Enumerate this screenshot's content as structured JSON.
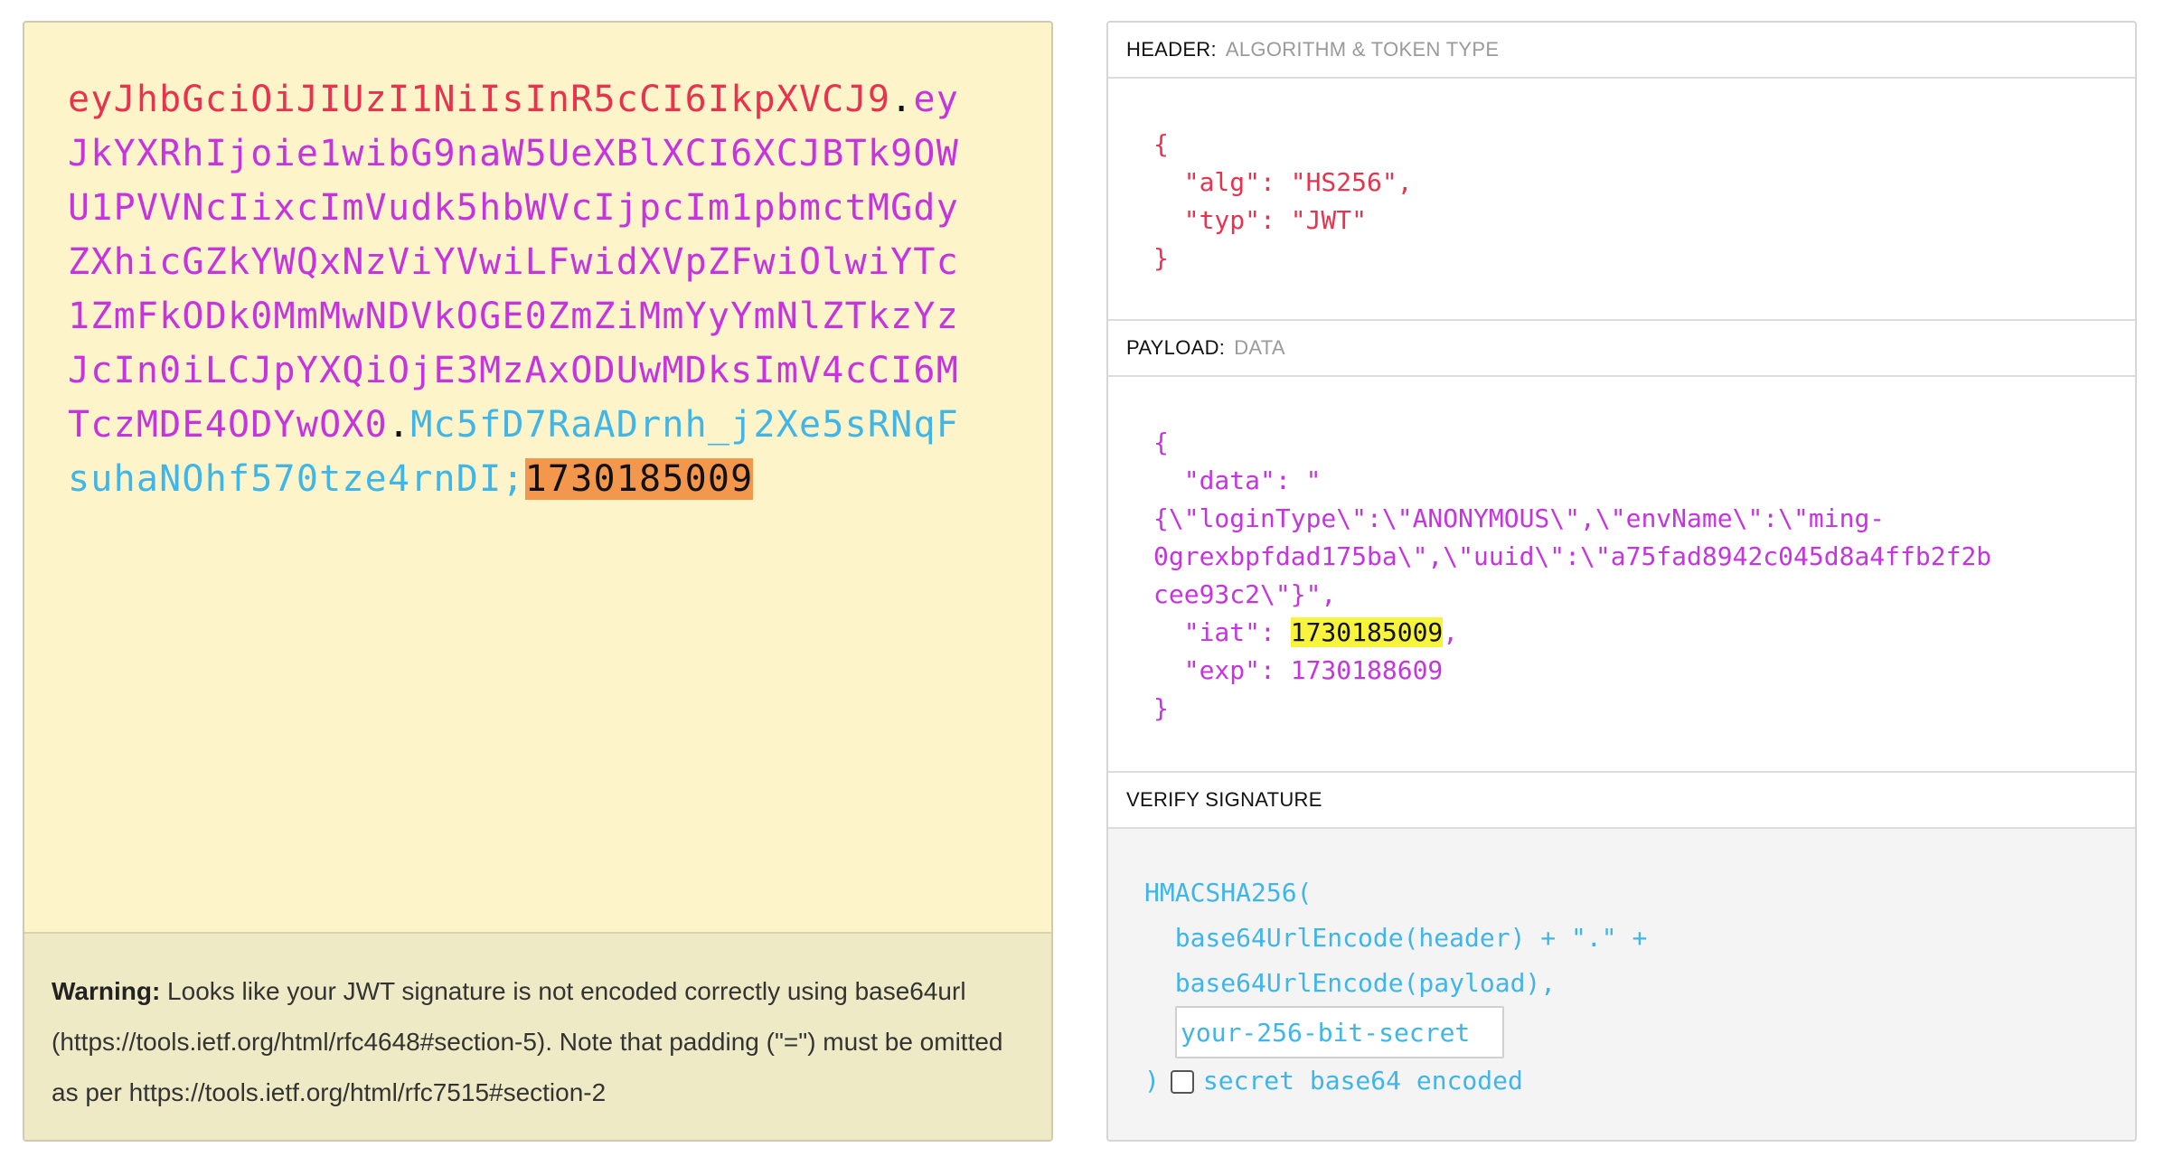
{
  "encoded": {
    "header": "eyJhbGciOiJIUzI1NiIsInR5cCI6IkpXVCJ9",
    "dot1": ".",
    "payload": "eyJkYXRhIjoie1wibG9naW5UeXBlXCI6XCJBTk9OWU1PVVNcIixcImVudk5hbWVcIjpcIm1pbmctMGdyZXhicGZkYWQxNzViYVwiLFwidXVpZFwiOlwiYTc1ZmFkODk0MmMwNDVkOGE0ZmZiMmYyYmNlZTkzYzJcIn0iLCJpYXQiOjE3MzAxODUwMDksImV4cCI6MTczMDE4ODYwOX0",
    "dot2": ".",
    "signature": "Mc5fD7RaADrnh_j2Xe5sRNqFsuhaNOhf570tze4rnDI;",
    "invalid_suffix": "1730185009"
  },
  "warning": {
    "label": "Warning:",
    "text": " Looks like your JWT signature is not encoded correctly using base64url (https://tools.ietf.org/html/rfc4648#section-5). Note that padding (\"=\") must be omitted as per https://tools.ietf.org/html/rfc7515#section-2"
  },
  "header_section": {
    "title": "HEADER:",
    "subtitle": "ALGORITHM & TOKEN TYPE",
    "json_open": "{",
    "line1": "  \"alg\": \"HS256\",",
    "line2": "  \"typ\": \"JWT\"",
    "json_close": "}"
  },
  "payload_section": {
    "title": "PAYLOAD:",
    "subtitle": "DATA",
    "json_open": "{",
    "line1": "  \"data\": \"",
    "line2": "{\\\"loginType\\\":\\\"ANONYMOUS\\\",\\\"envName\\\":\\\"ming-",
    "line3": "0grexbpfdad175ba\\\",\\\"uuid\\\":\\\"a75fad8942c045d8a4ffb2f2b",
    "line4": "cee93c2\\\"}\",",
    "iat_key": "  \"iat\": ",
    "iat_value": "1730185009",
    "iat_comma": ",",
    "exp_line": "  \"exp\": 1730188609",
    "json_close": "}"
  },
  "verify_section": {
    "title": "VERIFY SIGNATURE",
    "fn": "HMACSHA256(",
    "arg1": "  base64UrlEncode(header) + \".\" +",
    "arg2": "  base64UrlEncode(payload),",
    "secret_placeholder": "your-256-bit-secret",
    "close_paren": ")",
    "checkbox_label": "secret base64 encoded"
  },
  "colors": {
    "header": "#e8334e",
    "payload": "#c634e0",
    "signature": "#3fb5e8",
    "invalid_highlight": "#f2974b",
    "iat_highlight": "#f8f43b"
  }
}
